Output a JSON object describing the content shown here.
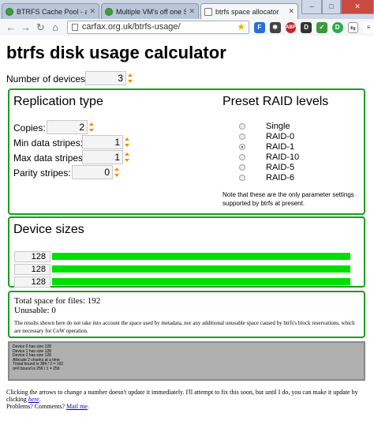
{
  "browser": {
    "tabs": [
      {
        "title": "BTRFS Cache Pool - availa",
        "icon": "green-circle-icon"
      },
      {
        "title": "Multiple VM's off one SSD",
        "icon": "green-circle-icon"
      },
      {
        "title": "btrfs space allocator",
        "icon": "document-icon"
      }
    ],
    "url": "carfax.org.uk/btrfs-usage/",
    "win_min": "–",
    "win_max": "□",
    "win_close": "✕"
  },
  "page": {
    "title": "btrfs disk usage calculator",
    "num_devices_label": "Number of devices:",
    "num_devices": "3"
  },
  "replication": {
    "heading": "Replication type",
    "copies_label": "Copies:",
    "copies": "2",
    "min_stripes_label": "Min data stripes:",
    "min_stripes": "1",
    "max_stripes_label": "Max data stripes:",
    "max_stripes": "1",
    "parity_label": "Parity stripes:",
    "parity": "0"
  },
  "preset": {
    "heading": "Preset RAID levels",
    "options": [
      "Single",
      "RAID-0",
      "RAID-1",
      "RAID-10",
      "RAID-5",
      "RAID-6"
    ],
    "selected": "RAID-1",
    "note": "Note that these are the only parameter settings supported by btrfs at present."
  },
  "devices": {
    "heading": "Device sizes",
    "sizes": [
      "128",
      "128",
      "128"
    ],
    "usage_fraction": [
      1.0,
      1.0,
      1.0
    ],
    "bar_color": "#00e000"
  },
  "results": {
    "total": "Total space for files: 192",
    "unusable": "Unusable: 0",
    "note": "The results shown here do not take into account the space used by metadata, nor any additional unusable space caused by btrfs's block reservations, which are necessary for CoW operation."
  },
  "debug": {
    "lines": [
      "Device 0 has size 128",
      "Device 1 has size 128",
      "Device 2 has size 128",
      "Allocate 2 chunks at a time",
      "Trivial bound is 384 / 2 = 192",
      "q=0 bound is 256 / 1 = 256"
    ]
  },
  "footer": {
    "text1": "Clicking the arrows to change a number doesn't update it immediately. I'll attempt to fix this soon, but until I do, you can make it update by clicking ",
    "link1": "here",
    "text1b": ".",
    "text2": "Problems? Comments? ",
    "link2": "Mail me",
    "text2b": "."
  },
  "colors": {
    "panel_border": "#19a019",
    "spinner_arrow": "#f08c00"
  }
}
